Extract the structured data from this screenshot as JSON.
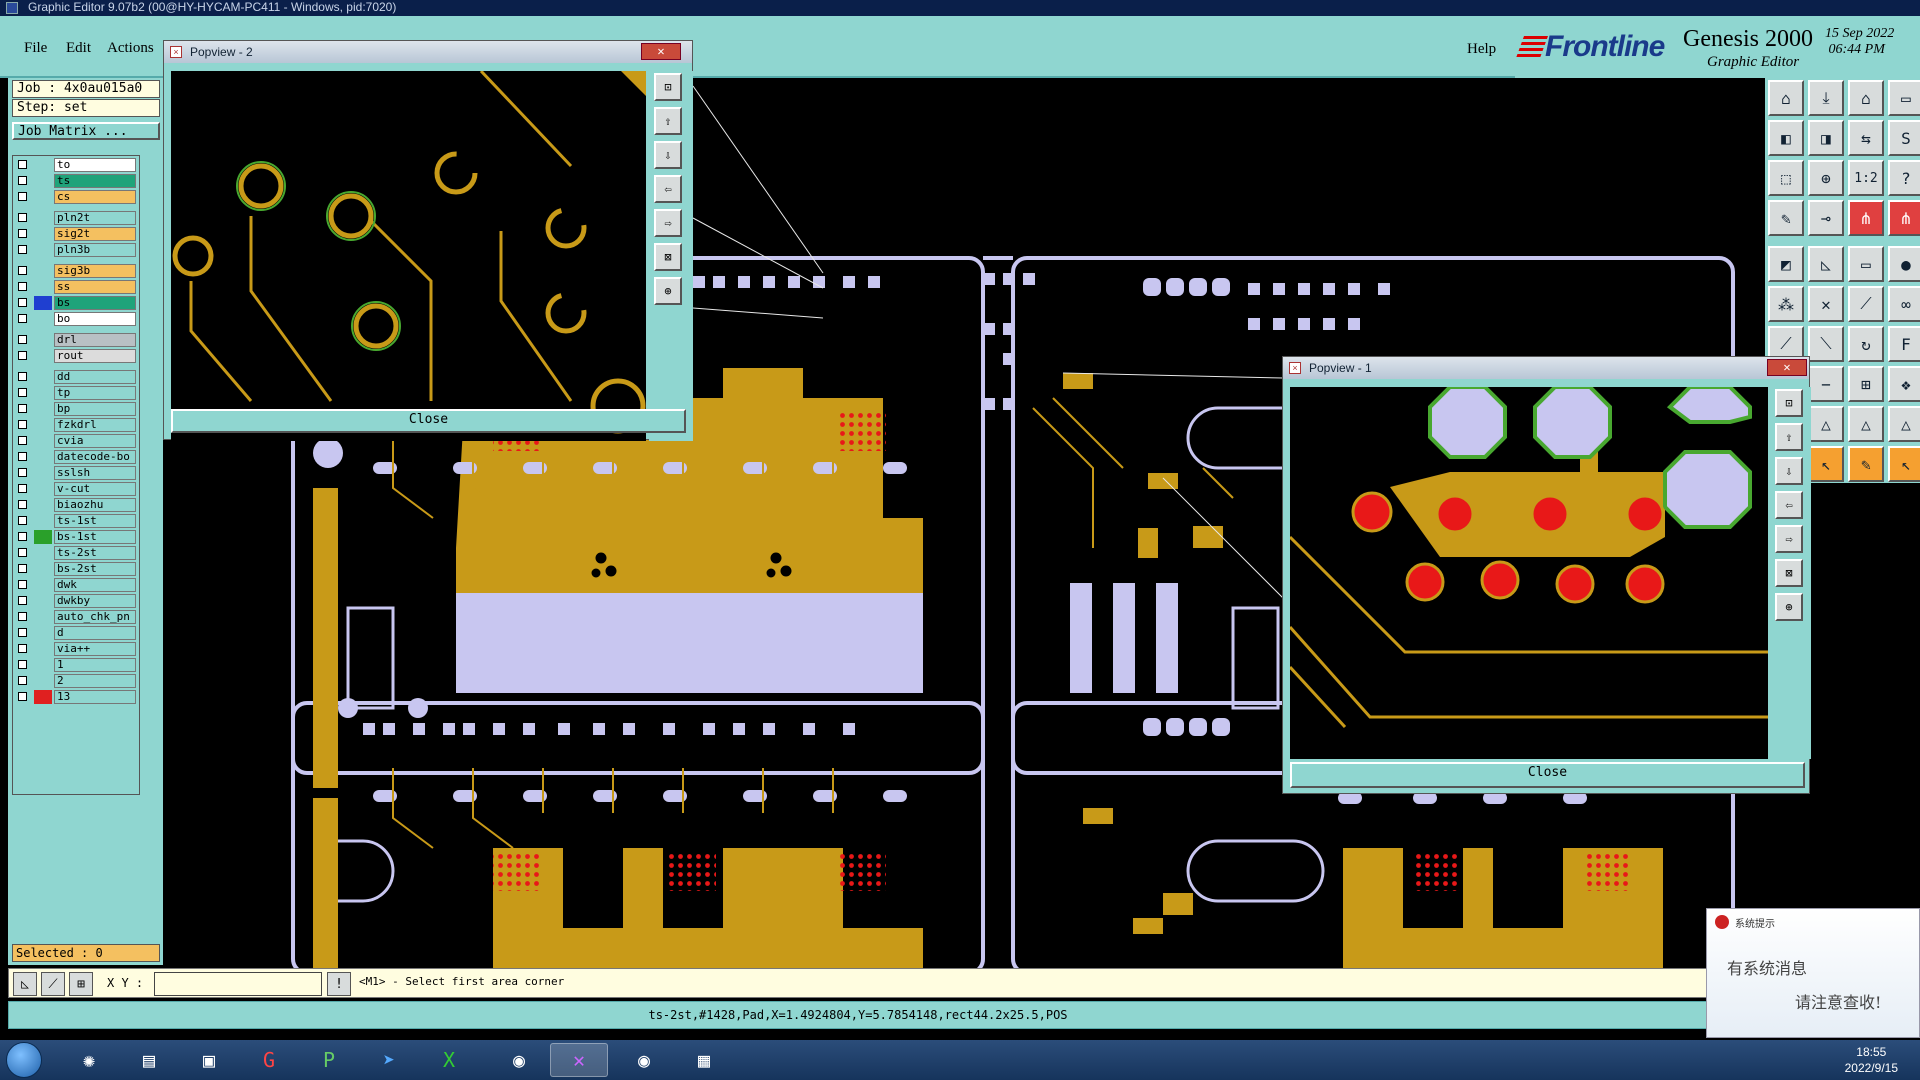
{
  "window": {
    "title": "Graphic Editor 9.07b2 (00@HY-HYCAM-PC411 - Windows, pid:7020)"
  },
  "menu": {
    "file": "File",
    "edit": "Edit",
    "actions": "Actions",
    "help": "Help"
  },
  "brand": {
    "frontline": "Frontline",
    "genesis": "Genesis 2000",
    "editor": "Graphic Editor",
    "datetime": "15 Sep 2022\n 06:44 PM"
  },
  "job": {
    "job": "Job : 4x0au015a0",
    "step": "Step: set",
    "matrix": "Job Matrix ..."
  },
  "layers": [
    {
      "name": "to",
      "color": "#ffffff",
      "mark": ""
    },
    {
      "name": "ts",
      "color": "#1fa37a",
      "mark": ""
    },
    {
      "name": "cs",
      "color": "#f4c060",
      "mark": ""
    },
    {
      "name": "pln2t",
      "color": "#8fd6d0",
      "mark": ""
    },
    {
      "name": "sig2t",
      "color": "#f4c060",
      "mark": ""
    },
    {
      "name": "pln3b",
      "color": "#8fd6d0",
      "mark": ""
    },
    {
      "name": "sig3b",
      "color": "#f4c060",
      "mark": ""
    },
    {
      "name": "ss",
      "color": "#f4c060",
      "mark": ""
    },
    {
      "name": "bs",
      "color": "#1fa37a",
      "mark": "#1f3fd0"
    },
    {
      "name": "bo",
      "color": "#ffffff",
      "mark": ""
    },
    {
      "name": "drl",
      "color": "#b8c0c4",
      "mark": ""
    },
    {
      "name": "rout",
      "color": "#dcdcdc",
      "mark": ""
    },
    {
      "name": "dd",
      "color": "#8fd6d0",
      "mark": ""
    },
    {
      "name": "tp",
      "color": "#8fd6d0",
      "mark": ""
    },
    {
      "name": "bp",
      "color": "#8fd6d0",
      "mark": ""
    },
    {
      "name": "fzkdrl",
      "color": "#8fd6d0",
      "mark": ""
    },
    {
      "name": "cvia",
      "color": "#8fd6d0",
      "mark": ""
    },
    {
      "name": "datecode-bo",
      "color": "#8fd6d0",
      "mark": ""
    },
    {
      "name": "sslsh",
      "color": "#8fd6d0",
      "mark": ""
    },
    {
      "name": "v-cut",
      "color": "#8fd6d0",
      "mark": ""
    },
    {
      "name": "biaozhu",
      "color": "#8fd6d0",
      "mark": ""
    },
    {
      "name": "ts-1st",
      "color": "#8fd6d0",
      "mark": ""
    },
    {
      "name": "bs-1st",
      "color": "#8fd6d0",
      "mark": "#2aa02a"
    },
    {
      "name": "ts-2st",
      "color": "#8fd6d0",
      "mark": ""
    },
    {
      "name": "bs-2st",
      "color": "#8fd6d0",
      "mark": ""
    },
    {
      "name": "dwk",
      "color": "#8fd6d0",
      "mark": ""
    },
    {
      "name": "dwkby",
      "color": "#8fd6d0",
      "mark": ""
    },
    {
      "name": "auto_chk_pn",
      "color": "#8fd6d0",
      "mark": ""
    },
    {
      "name": "d",
      "color": "#8fd6d0",
      "mark": ""
    },
    {
      "name": "via++",
      "color": "#8fd6d0",
      "mark": ""
    },
    {
      "name": "1",
      "color": "#8fd6d0",
      "mark": ""
    },
    {
      "name": "2",
      "color": "#8fd6d0",
      "mark": ""
    },
    {
      "name": "13",
      "color": "#8fd6d0",
      "mark": "#e02020"
    }
  ],
  "selected": "Selected : 0",
  "status": {
    "xy_label": "X Y :",
    "xy_value": "",
    "prompt": "<M1> - Select first area corner",
    "info": "ts-2st,#1428,Pad,X=1.4924804,Y=5.7854148,rect44.2x25.5,POS"
  },
  "popview2": {
    "title": "Popview - 2",
    "close": "Close"
  },
  "popview1": {
    "title": "Popview - 1",
    "close": "Close"
  },
  "notification": {
    "title": "系统提示",
    "line1": "有系统消息",
    "line2": "请注意查收!"
  },
  "clock": {
    "time": "18:55",
    "date": "2022/9/15"
  },
  "colors": {
    "board_outline": "#c8c6f0",
    "copper": "#c89a18",
    "pad_red": "#e81818",
    "mask_green": "#48a830",
    "ui_teal": "#8fd6d0"
  }
}
